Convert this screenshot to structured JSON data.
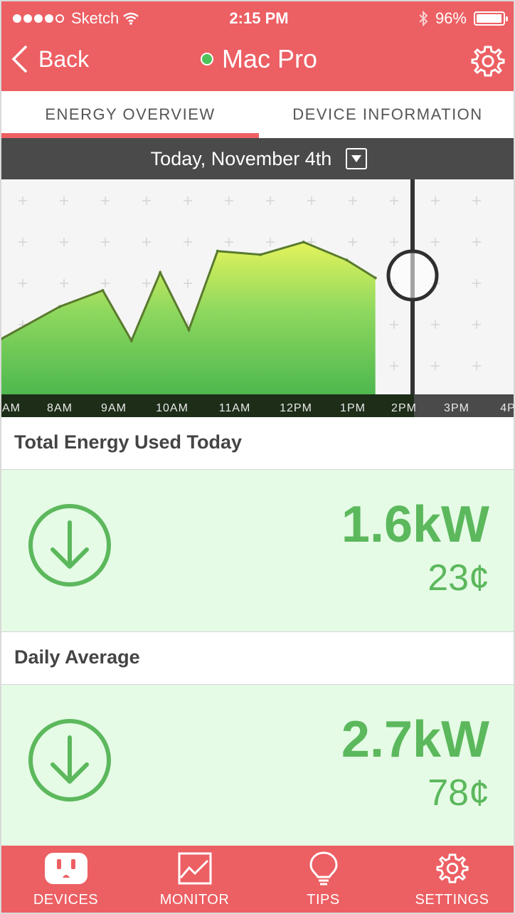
{
  "status": {
    "carrier": "Sketch",
    "time": "2:15 PM",
    "battery": "96%",
    "battery_level": 0.96
  },
  "nav": {
    "back_label": "Back",
    "title": "Mac Pro",
    "online": true
  },
  "tabs": [
    {
      "label": "ENERGY OVERVIEW",
      "active": true
    },
    {
      "label": "DEVICE INFORMATION",
      "active": false
    }
  ],
  "date_label": "Today, November 4th",
  "chart_data": {
    "type": "area",
    "x": [
      "AM",
      "8AM",
      "9AM",
      "10AM",
      "11AM",
      "12PM",
      "1PM",
      "2PM",
      "3PM",
      "4P"
    ],
    "series": [
      {
        "values": [
          1.55,
          2.45,
          2.9,
          1.5,
          3.4,
          1.8,
          4.0,
          3.9,
          4.25,
          3.75,
          3.25
        ]
      }
    ],
    "value_x": [
      "7:30AM",
      "8:00AM",
      "8:45AM",
      "9:15AM",
      "9:45AM",
      "10:15AM",
      "10:45AM",
      "11:30AM",
      "12:15PM",
      "1:00PM",
      "1:30PM"
    ],
    "current_marker": "2PM",
    "ylim": [
      0,
      6
    ],
    "grid": true
  },
  "sections": [
    {
      "label": "Total Energy Used Today",
      "kw": "1.6kW",
      "cost": "23¢"
    },
    {
      "label": "Daily Average",
      "kw": "2.7kW",
      "cost": "78¢"
    }
  ],
  "tabbar": [
    {
      "label": "DEVICES",
      "icon": "outlet-icon",
      "active": true
    },
    {
      "label": "MONITOR",
      "icon": "chart-icon",
      "active": false
    },
    {
      "label": "TIPS",
      "icon": "lightbulb-icon",
      "active": false
    },
    {
      "label": "SETTINGS",
      "icon": "gear-icon",
      "active": false
    }
  ],
  "colors": {
    "brand": "#ec5f63",
    "accent_green": "#5cb85c",
    "panel_bg": "#e5fbe6",
    "chart_line": "#5a7a2e"
  }
}
